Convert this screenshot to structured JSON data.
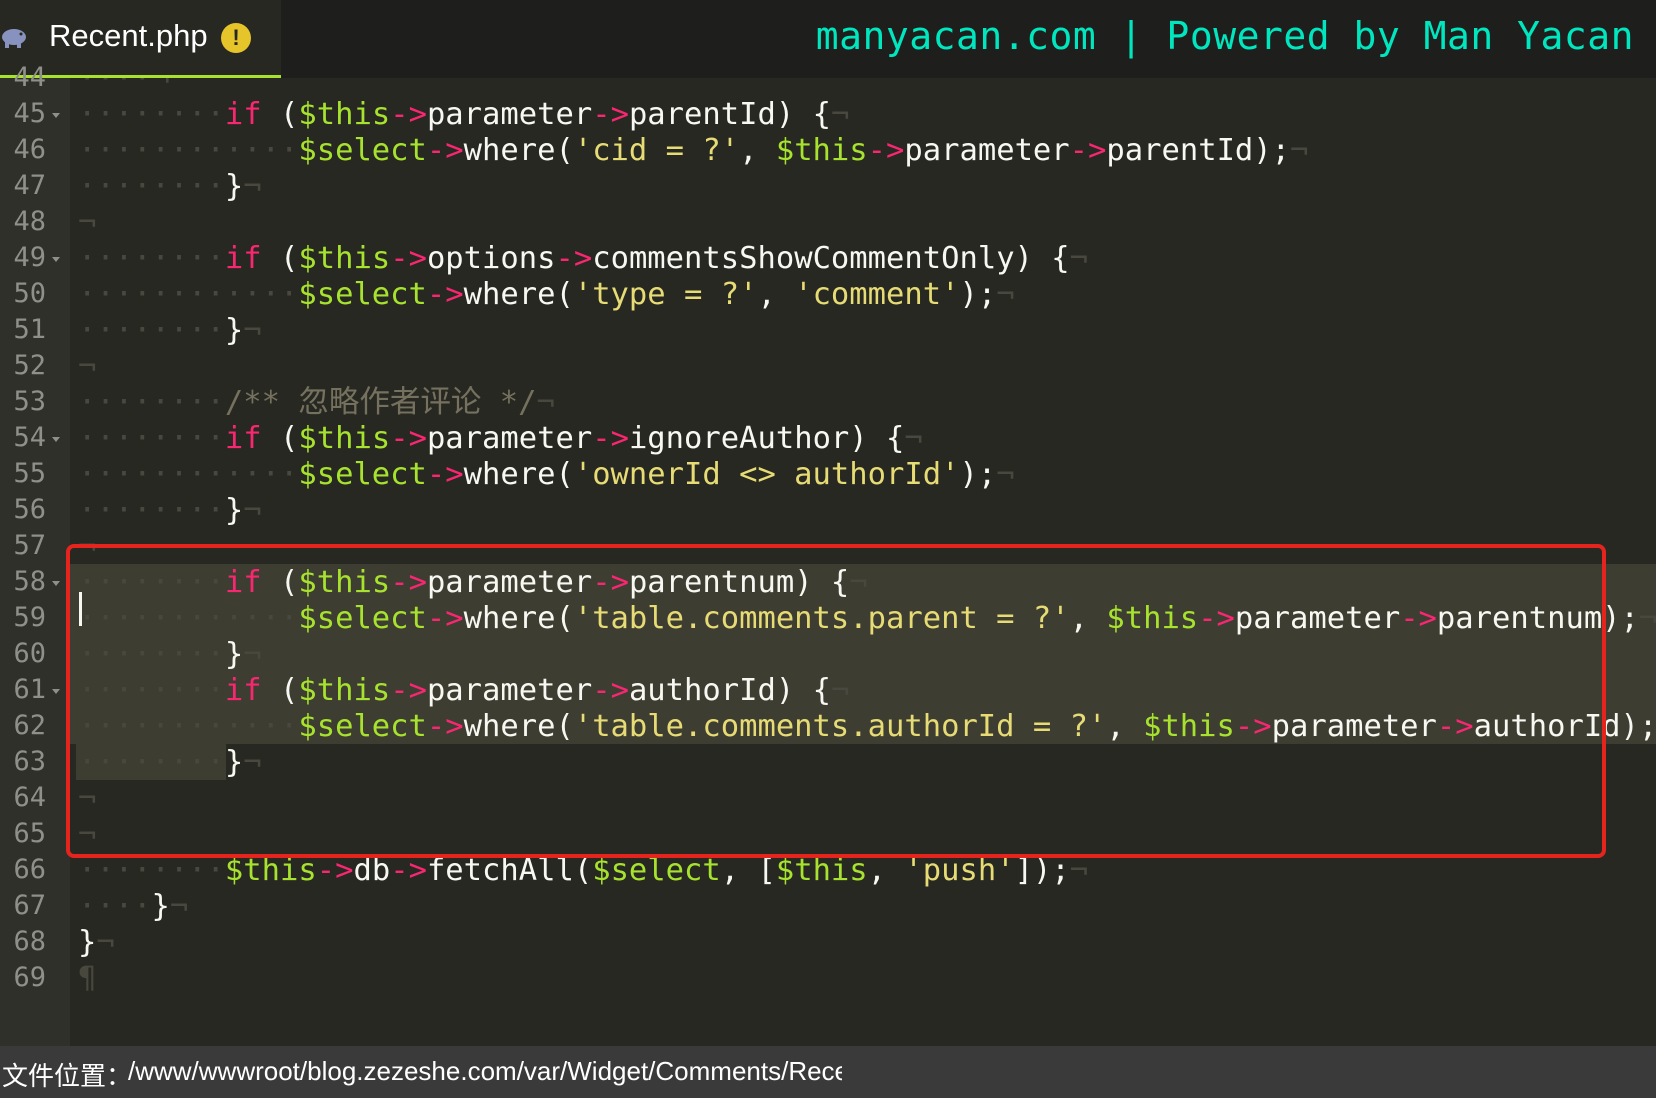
{
  "tab": {
    "label": "Recent.php",
    "icon": "php-elephant-icon",
    "warning": "!"
  },
  "watermark": "manyacan.com | Powered by Man Yacan",
  "colors": {
    "keyword": "#f92672",
    "variable": "#a6e22e",
    "string": "#e6db74",
    "comment": "#75715e",
    "highlight_box": "#e5241d",
    "watermark": "#00e7c0"
  },
  "editor": {
    "line_numbers": [
      "44",
      "45",
      "46",
      "47",
      "48",
      "49",
      "50",
      "51",
      "52",
      "53",
      "54",
      "55",
      "56",
      "57",
      "58",
      "59",
      "60",
      "61",
      "62",
      "63",
      "64",
      "65",
      "66",
      "67",
      "68",
      "69"
    ],
    "fold_lines": [
      "45",
      "49",
      "54",
      "58",
      "61"
    ],
    "cursor_line": "58",
    "highlighted_lines": [
      "58",
      "59",
      "60",
      "61",
      "62",
      "63"
    ],
    "boxed_lines": [
      "57",
      "64"
    ],
    "lines": [
      {
        "n": "44",
        "indent": 1,
        "tokens": []
      },
      {
        "n": "45",
        "indent": 2,
        "tokens": [
          [
            "kw",
            "if"
          ],
          [
            "plain",
            " ("
          ],
          [
            "var",
            "$this"
          ],
          [
            "op",
            "->"
          ],
          [
            "plain",
            "parameter"
          ],
          [
            "op",
            "->"
          ],
          [
            "plain",
            "parentId) {"
          ]
        ]
      },
      {
        "n": "46",
        "indent": 3,
        "tokens": [
          [
            "var",
            "$select"
          ],
          [
            "op",
            "->"
          ],
          [
            "plain",
            "where("
          ],
          [
            "str",
            "'cid = ?'"
          ],
          [
            "plain",
            ", "
          ],
          [
            "var",
            "$this"
          ],
          [
            "op",
            "->"
          ],
          [
            "plain",
            "parameter"
          ],
          [
            "op",
            "->"
          ],
          [
            "plain",
            "parentId);"
          ]
        ]
      },
      {
        "n": "47",
        "indent": 2,
        "tokens": [
          [
            "plain",
            "}"
          ]
        ]
      },
      {
        "n": "48",
        "indent": 0,
        "tokens": []
      },
      {
        "n": "49",
        "indent": 2,
        "tokens": [
          [
            "kw",
            "if"
          ],
          [
            "plain",
            " ("
          ],
          [
            "var",
            "$this"
          ],
          [
            "op",
            "->"
          ],
          [
            "plain",
            "options"
          ],
          [
            "op",
            "->"
          ],
          [
            "plain",
            "commentsShowCommentOnly) {"
          ]
        ]
      },
      {
        "n": "50",
        "indent": 3,
        "tokens": [
          [
            "var",
            "$select"
          ],
          [
            "op",
            "->"
          ],
          [
            "plain",
            "where("
          ],
          [
            "str",
            "'type = ?'"
          ],
          [
            "plain",
            ", "
          ],
          [
            "str",
            "'comment'"
          ],
          [
            "plain",
            ");"
          ]
        ]
      },
      {
        "n": "51",
        "indent": 2,
        "tokens": [
          [
            "plain",
            "}"
          ]
        ]
      },
      {
        "n": "52",
        "indent": 0,
        "tokens": []
      },
      {
        "n": "53",
        "indent": 2,
        "tokens": [
          [
            "cm",
            "/** 忽略作者评论 */"
          ]
        ]
      },
      {
        "n": "54",
        "indent": 2,
        "tokens": [
          [
            "kw",
            "if"
          ],
          [
            "plain",
            " ("
          ],
          [
            "var",
            "$this"
          ],
          [
            "op",
            "->"
          ],
          [
            "plain",
            "parameter"
          ],
          [
            "op",
            "->"
          ],
          [
            "plain",
            "ignoreAuthor) {"
          ]
        ]
      },
      {
        "n": "55",
        "indent": 3,
        "tokens": [
          [
            "var",
            "$select"
          ],
          [
            "op",
            "->"
          ],
          [
            "plain",
            "where("
          ],
          [
            "str",
            "'ownerId <> authorId'"
          ],
          [
            "plain",
            ");"
          ]
        ]
      },
      {
        "n": "56",
        "indent": 2,
        "tokens": [
          [
            "plain",
            "}"
          ]
        ]
      },
      {
        "n": "57",
        "indent": 0,
        "tokens": []
      },
      {
        "n": "58",
        "indent": 2,
        "tokens": [
          [
            "kw",
            "if"
          ],
          [
            "plain",
            " ("
          ],
          [
            "var",
            "$this"
          ],
          [
            "op",
            "->"
          ],
          [
            "plain",
            "parameter"
          ],
          [
            "op",
            "->"
          ],
          [
            "plain",
            "parentnum) {"
          ]
        ]
      },
      {
        "n": "59",
        "indent": 3,
        "tokens": [
          [
            "var",
            "$select"
          ],
          [
            "op",
            "->"
          ],
          [
            "plain",
            "where("
          ],
          [
            "str",
            "'table.comments.parent = ?'"
          ],
          [
            "plain",
            ", "
          ],
          [
            "var",
            "$this"
          ],
          [
            "op",
            "->"
          ],
          [
            "plain",
            "parameter"
          ],
          [
            "op",
            "->"
          ],
          [
            "plain",
            "parentnum);"
          ]
        ]
      },
      {
        "n": "60",
        "indent": 2,
        "tokens": [
          [
            "plain",
            "}"
          ]
        ]
      },
      {
        "n": "61",
        "indent": 2,
        "tokens": [
          [
            "kw",
            "if"
          ],
          [
            "plain",
            " ("
          ],
          [
            "var",
            "$this"
          ],
          [
            "op",
            "->"
          ],
          [
            "plain",
            "parameter"
          ],
          [
            "op",
            "->"
          ],
          [
            "plain",
            "authorId) {"
          ]
        ]
      },
      {
        "n": "62",
        "indent": 3,
        "tokens": [
          [
            "var",
            "$select"
          ],
          [
            "op",
            "->"
          ],
          [
            "plain",
            "where("
          ],
          [
            "str",
            "'table.comments.authorId = ?'"
          ],
          [
            "plain",
            ", "
          ],
          [
            "var",
            "$this"
          ],
          [
            "op",
            "->"
          ],
          [
            "plain",
            "parameter"
          ],
          [
            "op",
            "->"
          ],
          [
            "plain",
            "authorId);"
          ]
        ]
      },
      {
        "n": "63",
        "indent": 2,
        "tokens": [
          [
            "plain",
            "}"
          ]
        ]
      },
      {
        "n": "64",
        "indent": 0,
        "tokens": []
      },
      {
        "n": "65",
        "indent": 0,
        "tokens": []
      },
      {
        "n": "66",
        "indent": 2,
        "tokens": [
          [
            "var",
            "$this"
          ],
          [
            "op",
            "->"
          ],
          [
            "plain",
            "db"
          ],
          [
            "op",
            "->"
          ],
          [
            "plain",
            "fetchAll("
          ],
          [
            "var",
            "$select"
          ],
          [
            "plain",
            ", ["
          ],
          [
            "var",
            "$this"
          ],
          [
            "plain",
            ", "
          ],
          [
            "str",
            "'push'"
          ],
          [
            "plain",
            "]);"
          ]
        ]
      },
      {
        "n": "67",
        "indent": 1,
        "tokens": [
          [
            "plain",
            "}"
          ]
        ]
      },
      {
        "n": "68",
        "indent": 0,
        "tokens": [
          [
            "plain",
            "}"
          ]
        ]
      },
      {
        "n": "69",
        "indent": 0,
        "tokens": [
          [
            "eof",
            "¶"
          ]
        ]
      }
    ]
  },
  "statusbar": {
    "label": "文件位置：",
    "path": "/www/wwwroot/blog.zezeshe.com/var/Widget/Comments/Rece"
  }
}
